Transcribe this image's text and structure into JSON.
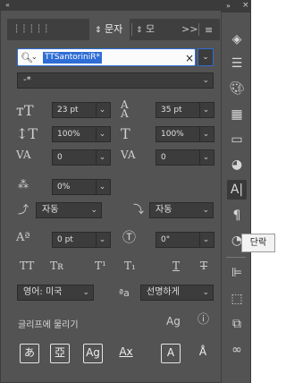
{
  "tabs": {
    "active": "문자",
    "second": "모",
    "overflow": ">>"
  },
  "font": {
    "family_value": "TTSantoriniR*",
    "style_value": "-*"
  },
  "size": {
    "font_size": "23 pt",
    "leading": "35 pt"
  },
  "scale": {
    "vertical": "100%",
    "horizontal": "100%"
  },
  "spacing": {
    "kerning": "0",
    "tracking": "0",
    "tsume": "0%"
  },
  "aki": {
    "left": "자동",
    "right": "자동"
  },
  "baseline": {
    "shift": "0 pt",
    "rotation": "0°"
  },
  "language": {
    "value": "영어: 미국",
    "antialias": "선명하게"
  },
  "snap_label": "글리프에 물리기",
  "bottom_glyphs": [
    "あ",
    "亞",
    "Ag",
    "Ax",
    "A",
    "Å"
  ],
  "tooltip": "단락",
  "colors": {
    "panel": "#535353",
    "field": "#3c3c3c",
    "accent": "#2f6dd6"
  }
}
